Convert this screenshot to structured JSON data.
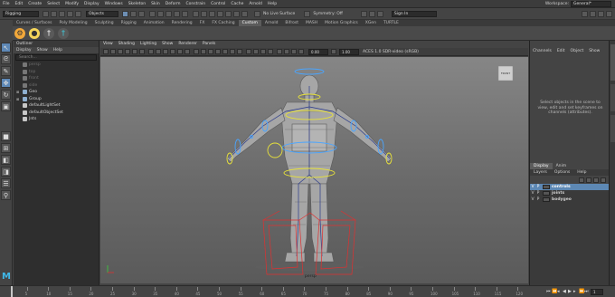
{
  "menubar": {
    "items": [
      "File",
      "Edit",
      "Create",
      "Select",
      "Modify",
      "Display",
      "Windows",
      "Skeleton",
      "Skin",
      "Deform",
      "Constrain",
      "Control",
      "Cache",
      "Arnold",
      "Help"
    ],
    "workspace_label": "Workspace:",
    "workspace_value": "General*"
  },
  "statusline": {
    "menuset": "Rigging",
    "objects_label": "Objects",
    "live_surface": "No Live Surface",
    "symmetry": "Symmetry: Off",
    "sign_in": "Sign In"
  },
  "shelf": {
    "tabs": [
      "Curves / Surfaces",
      "Poly Modeling",
      "Sculpting",
      "Rigging",
      "Animation",
      "Rendering",
      "FX",
      "FX Caching",
      "Custom",
      "Arnold",
      "Bifrost",
      "MASH",
      "Motion Graphics",
      "XGen",
      "TURTLE"
    ],
    "active_tab": "Custom"
  },
  "outliner": {
    "title": "Outliner",
    "menu": [
      "Display",
      "Show",
      "Help"
    ],
    "search_placeholder": "Search...",
    "items": [
      {
        "label": "persp",
        "dim": true,
        "color": "#777777"
      },
      {
        "label": "top",
        "dim": true,
        "color": "#777777"
      },
      {
        "label": "front",
        "dim": true,
        "color": "#777777"
      },
      {
        "label": "side",
        "dim": true,
        "color": "#777777"
      },
      {
        "label": "Geo",
        "dim": false,
        "color": "#8fb0d0"
      },
      {
        "label": "Group",
        "dim": false,
        "color": "#8fb0d0"
      },
      {
        "label": "defaultLightSet",
        "dim": false,
        "color": "#c7c7c7"
      },
      {
        "label": "defaultObjectSet",
        "dim": false,
        "color": "#c7c7c7"
      },
      {
        "label": "Jnts",
        "dim": false,
        "color": "#c7c7c7"
      }
    ]
  },
  "viewport": {
    "menu": [
      "View",
      "Shading",
      "Lighting",
      "Show",
      "Renderer",
      "Panels"
    ],
    "exposure": "0.00",
    "gamma": "1.00",
    "colorspace": "ACES 1.0 SDR-video (sRGB)",
    "camera_label": "persp",
    "viewcube_label": "FRONT"
  },
  "channelbox": {
    "menu": [
      "Channels",
      "Edit",
      "Object",
      "Show"
    ],
    "message": "Select objects in the scene to view, edit and set keyframes on channels (attributes)."
  },
  "layers": {
    "tabs": [
      "Display",
      "Anim"
    ],
    "active_tab": "Display",
    "menu": [
      "Layers",
      "Options",
      "Help"
    ],
    "rows": [
      {
        "v": "V",
        "p": "P",
        "label": "controls",
        "selected": true
      },
      {
        "v": "V",
        "p": "P",
        "label": "joints",
        "selected": false
      },
      {
        "v": "V",
        "p": "P",
        "label": "bodygeo",
        "selected": false
      }
    ]
  },
  "timeslider": {
    "ticks": [
      "5",
      "10",
      "15",
      "20",
      "25",
      "30",
      "35",
      "40",
      "45",
      "50",
      "55",
      "60",
      "65",
      "70",
      "75",
      "80",
      "85",
      "90",
      "95",
      "100",
      "105",
      "110",
      "115",
      "120"
    ],
    "current_frame": "1"
  },
  "colors": {
    "selection_blue": "#5d88b4",
    "viewport_bg": "#7a7a7a",
    "control_yellow": "#e8e23a",
    "control_blue": "#4aa5ff",
    "control_red": "#e03030"
  }
}
